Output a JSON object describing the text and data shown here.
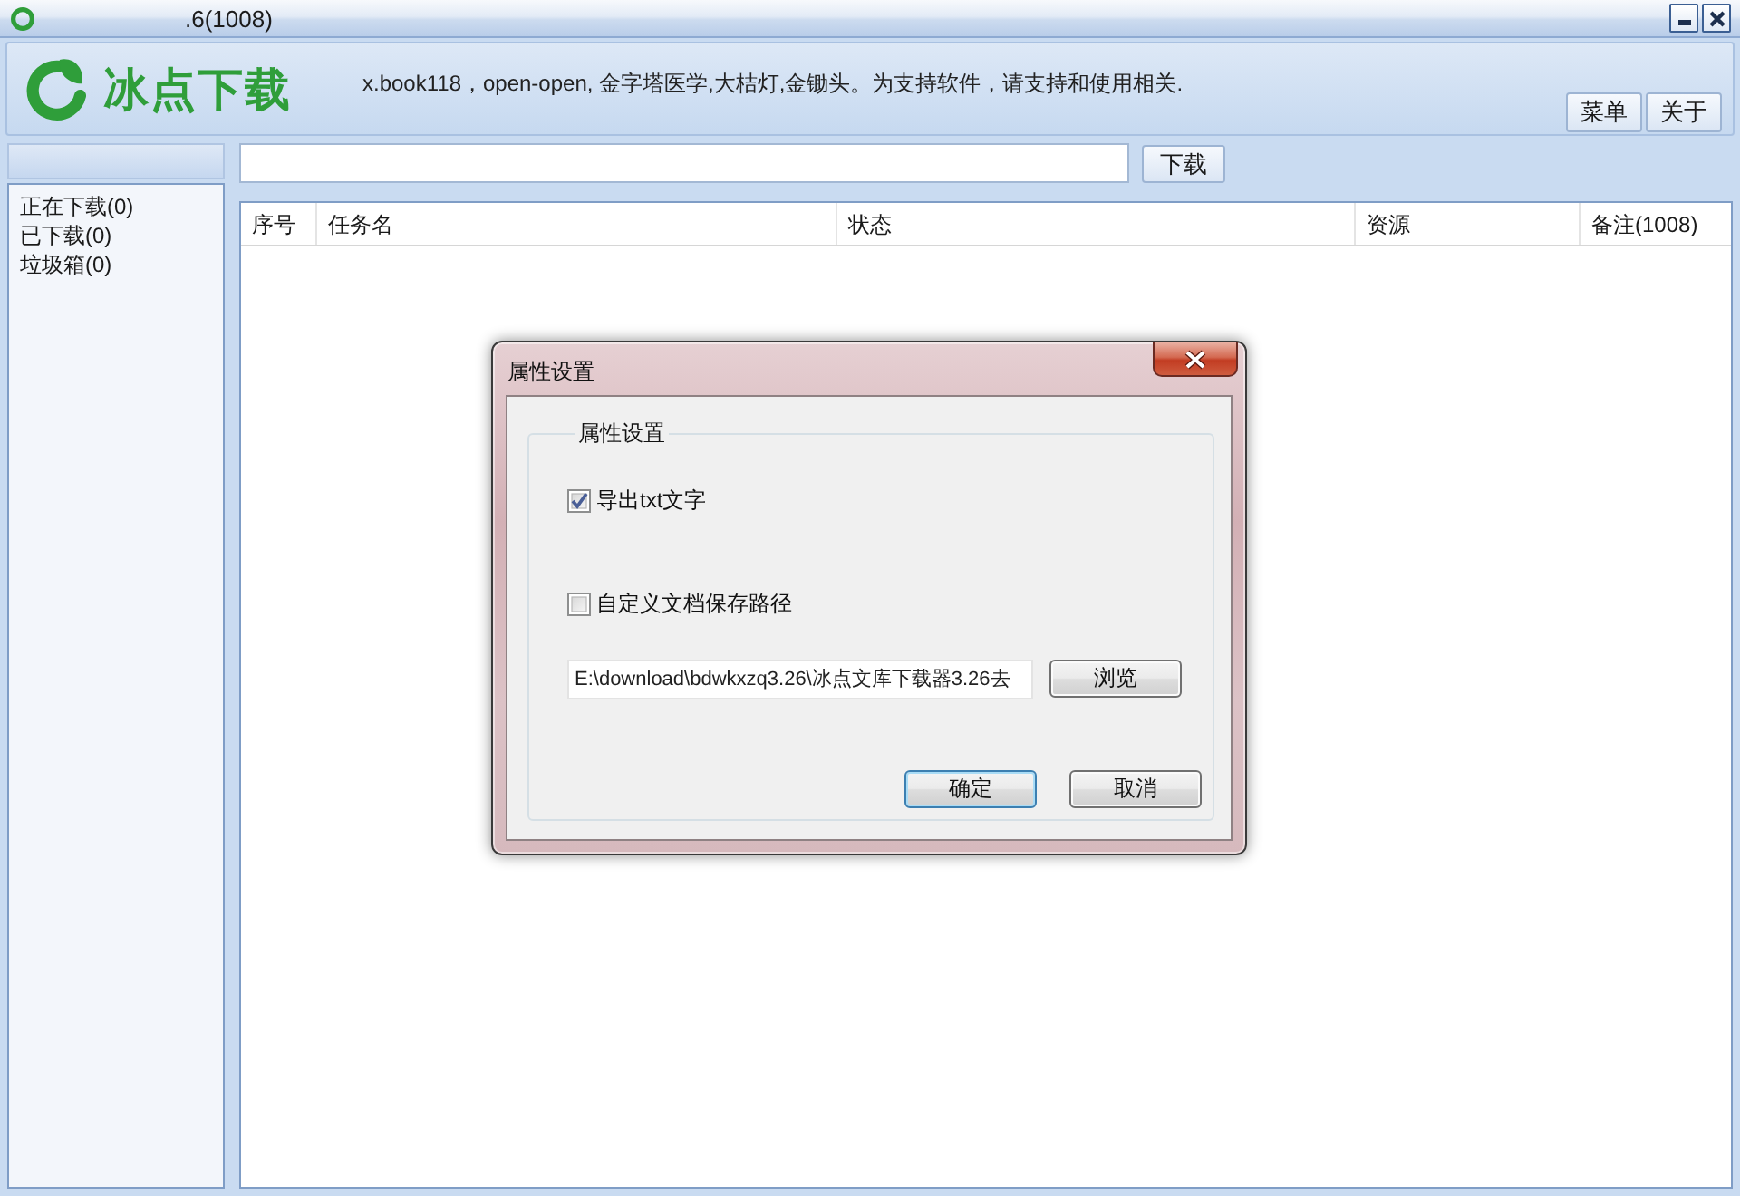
{
  "window": {
    "title": ".6(1008)"
  },
  "header": {
    "logo_text": "冰点下载",
    "notice": "x.book118，open-open, 金字塔医学,大桔灯,金锄头。为支持软件，请支持和使用相关.",
    "buttons": [
      "菜单",
      "关于"
    ]
  },
  "url_bar": {
    "button": "下载"
  },
  "sidebar": {
    "items": [
      {
        "label": "正在下载(0)",
        "selected": false
      },
      {
        "label": "已下载(0)",
        "selected": false
      },
      {
        "label": "垃圾箱(0)",
        "selected": false
      }
    ]
  },
  "table": {
    "columns": [
      "序号",
      "任务名",
      "状态",
      "资源",
      "备注(1008)"
    ]
  },
  "dialog": {
    "title": "属性设置",
    "group_label": "属性设置",
    "options": [
      {
        "label": "导出txt文字",
        "checked": true
      },
      {
        "label": "自定义文档保存路径",
        "checked": false
      }
    ],
    "path": "E:\\download\\bdwkxzq3.26\\冰点文库下载器3.26去",
    "browse_button": "浏览",
    "buttons": [
      {
        "label": "确定",
        "default": true
      },
      {
        "label": "取消",
        "default": false
      }
    ]
  }
}
